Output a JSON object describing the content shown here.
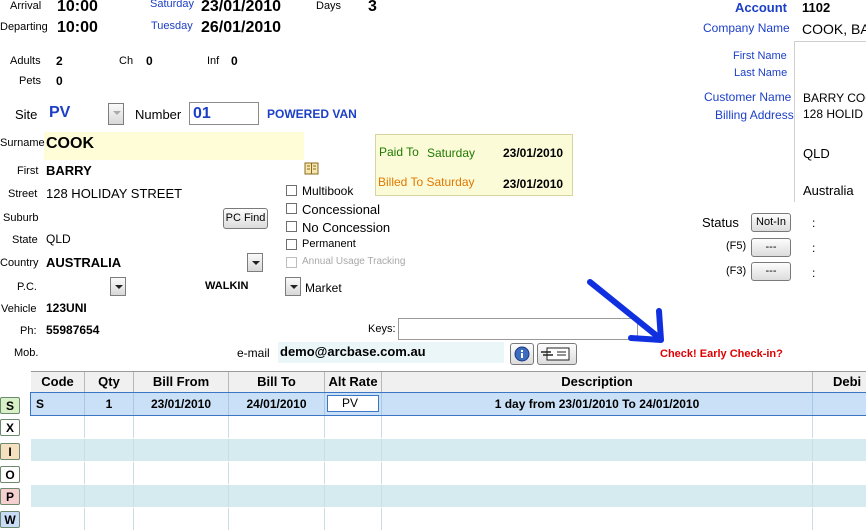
{
  "header": {
    "arrival_label": "Arrival",
    "arrival_time": "10:00",
    "arrival_day": "Saturday",
    "arrival_date": "23/01/2010",
    "days_label": "Days",
    "days_value": "3",
    "departing_label": "Departing",
    "departing_time": "10:00",
    "departing_day": "Tuesday",
    "departing_date": "26/01/2010"
  },
  "guests": {
    "adults_label": "Adults",
    "adults_value": "2",
    "ch_label": "Ch",
    "ch_value": "0",
    "inf_label": "Inf",
    "inf_value": "0",
    "pets_label": "Pets",
    "pets_value": "0"
  },
  "site": {
    "site_label": "Site",
    "site_value": "PV",
    "number_label": "Number",
    "number_value": "01",
    "site_type": "POWERED VAN"
  },
  "customer": {
    "surname_label": "Surname",
    "surname_value": "COOK",
    "first_label": "First",
    "first_value": "BARRY",
    "street_label": "Street",
    "street_value": "128 HOLIDAY STREET",
    "suburb_label": "Suburb",
    "pcfind_label": "PC Find",
    "state_label": "State",
    "state_value": "QLD",
    "country_label": "Country",
    "country_value": "AUSTRALIA",
    "pc_label": "P.C.",
    "walkin": "WALKIN",
    "market_label": "Market",
    "vehicle_label": "Vehicle",
    "vehicle_value": "123UNI",
    "ph_label": "Ph:",
    "ph_value": "55987654",
    "mob_label": "Mob.",
    "email_label": "e-mail",
    "email_value": "demo@arcbase.com.au",
    "keys_label": "Keys:"
  },
  "payment": {
    "paid_to_label": "Paid To",
    "paid_to_day": "Saturday",
    "paid_to_date": "23/01/2010",
    "billed_to_label": "Billed To Saturday",
    "billed_to_date": "23/01/2010"
  },
  "options": [
    {
      "label": "Multibook",
      "checked": false,
      "disabled": false
    },
    {
      "label": "Concessional",
      "checked": false,
      "disabled": false
    },
    {
      "label": "No Concession",
      "checked": false,
      "disabled": false
    },
    {
      "label": "Permanent",
      "checked": false,
      "disabled": false
    },
    {
      "label": "Annual Usage Tracking",
      "checked": false,
      "disabled": true
    }
  ],
  "account": {
    "account_label": "Account",
    "account_value": "1102",
    "company_label": "Company Name",
    "company_value": "COOK, BA",
    "first_name_label": "First Name",
    "last_name_label": "Last Name",
    "customer_name_label": "Customer Name",
    "billing_address_label": "Billing Address",
    "address_lines": [
      "BARRY COO",
      "128 HOLID",
      "",
      "QLD",
      "",
      "Australia"
    ]
  },
  "status": {
    "status_label": "Status",
    "status_button": "Not-In",
    "status_colon": ":",
    "f5_label": "(F5)",
    "f5_button": "---",
    "f5_colon": ":",
    "f3_label": "(F3)",
    "f3_button": "---",
    "f3_colon": ":"
  },
  "warning": "Check! Early Check-in?",
  "grid": {
    "columns": [
      "Code",
      "Qty",
      "Bill From",
      "Bill To",
      "Alt Rate",
      "Description",
      "Debi"
    ],
    "rows": [
      {
        "code": "S",
        "qty": "1",
        "bill_from": "23/01/2010",
        "bill_to": "24/01/2010",
        "alt_rate": "PV",
        "description": "1 day from 23/01/2010 To 24/01/2010"
      }
    ]
  },
  "side_buttons": [
    "S",
    "X",
    "I",
    "O",
    "P",
    "W"
  ],
  "colors": {
    "accent_blue": "#1c3fc6",
    "paid_green": "#1f7a00",
    "billed_orange": "#e07800",
    "warning_red": "#e00000",
    "arrow_blue": "#1030e0",
    "row_selected": "#c9e0f6",
    "row_alt": "#d6ebf0"
  }
}
